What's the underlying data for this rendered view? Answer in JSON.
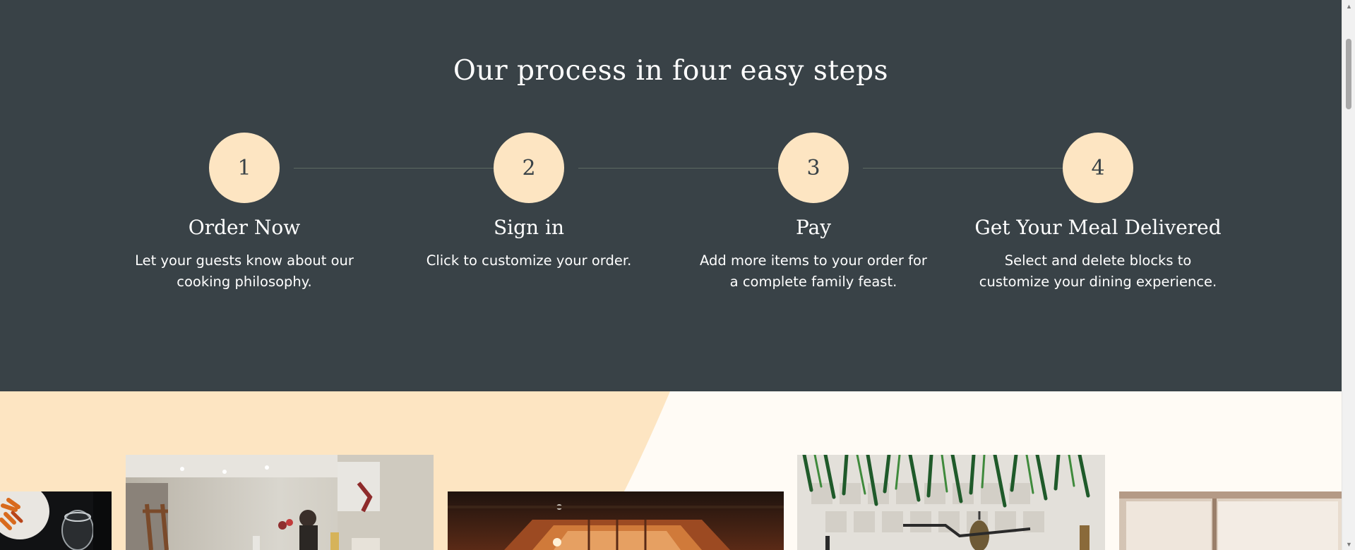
{
  "process": {
    "title": "Our process in four easy steps",
    "steps": [
      {
        "number": "1",
        "title": "Order Now",
        "description": "Let your guests know about our cooking philosophy."
      },
      {
        "number": "2",
        "title": "Sign in",
        "description": "Click to customize your order."
      },
      {
        "number": "3",
        "title": "Pay",
        "description": "Add more items to your order for a complete family feast."
      },
      {
        "number": "4",
        "title": "Get Your Meal Delivered",
        "description": "Select and delete blocks to customize your dining experience."
      }
    ]
  },
  "gallery": {
    "images": [
      "food-plate-photo",
      "cafe-interior-photo",
      "restaurant-ceiling-photo",
      "plants-kitchen-photo",
      "window-light-photo"
    ]
  },
  "colors": {
    "section_bg": "#394247",
    "circle_fill": "#fde5c2",
    "accent_beige": "#fde5c2",
    "page_bg": "#fffbf5",
    "text_light": "#ffffff"
  }
}
